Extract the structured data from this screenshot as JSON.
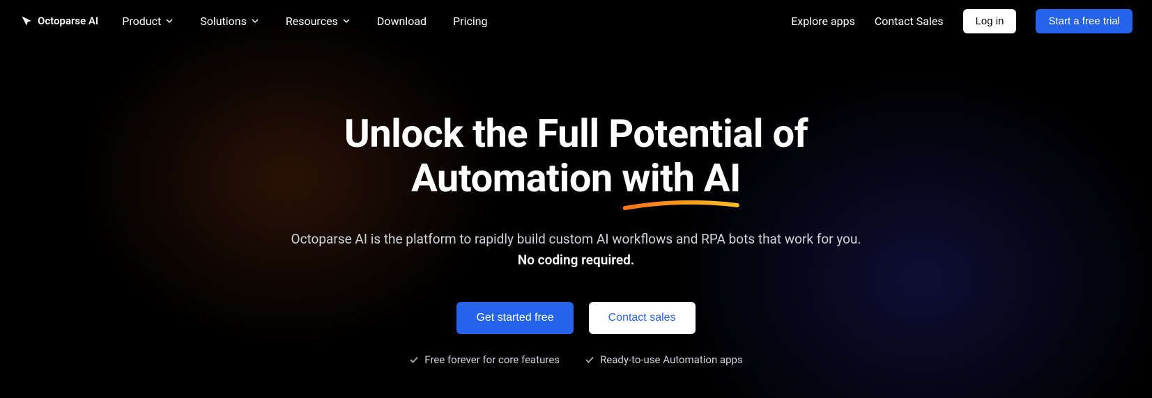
{
  "brand": {
    "name": "Octoparse AI"
  },
  "nav": {
    "items": [
      {
        "label": "Product",
        "hasDropdown": true
      },
      {
        "label": "Solutions",
        "hasDropdown": true
      },
      {
        "label": "Resources",
        "hasDropdown": true
      },
      {
        "label": "Download",
        "hasDropdown": false
      },
      {
        "label": "Pricing",
        "hasDropdown": false
      }
    ]
  },
  "headerRight": {
    "explore": "Explore apps",
    "contact": "Contact Sales",
    "login": "Log in",
    "trial": "Start a free trial"
  },
  "hero": {
    "title_line1": "Unlock the Full Potential of",
    "title_line2_prefix": "Automation ",
    "title_line2_highlight": "with AI",
    "subtitle_line1": "Octoparse AI is the platform to rapidly build custom AI workflows and RPA bots that work for you.",
    "subtitle_line2": "No coding required.",
    "cta_primary": "Get started free",
    "cta_secondary": "Contact sales",
    "features": [
      "Free forever for core features",
      "Ready-to-use Automation apps"
    ]
  }
}
